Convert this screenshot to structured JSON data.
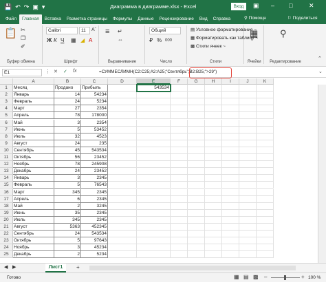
{
  "window": {
    "title": "Диаграмма в диаграмме.xlsx - Excel",
    "signin": "Вход",
    "qat_icons": [
      "save-icon",
      "undo-icon",
      "redo-icon",
      "image-icon",
      "customize-icon"
    ],
    "controls": [
      "ribbon-display-icon",
      "minimize-icon",
      "maximize-icon",
      "close-icon"
    ]
  },
  "tabs": [
    "Файл",
    "Главная",
    "Вставка",
    "Разметка страницы",
    "Формулы",
    "Данные",
    "Рецензирование",
    "Вид",
    "Справка"
  ],
  "tabs_extra": {
    "tell_me": "Помощн",
    "share": "Поделиться"
  },
  "ribbon": {
    "clipboard": {
      "label": "Буфер обмена"
    },
    "font": {
      "label": "Шрифт",
      "name": "Calibri",
      "size": "11"
    },
    "alignment": {
      "label": "Выравнивание"
    },
    "number": {
      "label": "Число",
      "format": "Общий"
    },
    "styles": {
      "label": "Стили",
      "items": [
        "Условное форматирование ~",
        "Форматировать как таблицу ~",
        "Стили ячеек ~"
      ]
    },
    "cells": {
      "label": "Ячейки"
    },
    "editing": {
      "label": "Редактирование"
    }
  },
  "formula_bar": {
    "name_box": "E1",
    "formula": "=СУММЕСЛИМН(C2:C25;A2:A25;\"Сентябрь\";B2:B25;\">29\")",
    "fx": "fx"
  },
  "columns": [
    "A",
    "B",
    "C",
    "D",
    "E",
    "F",
    "G",
    "H",
    "I",
    "J",
    "K"
  ],
  "selected_column": "E",
  "headers": {
    "a": "Месяц",
    "b": "Продано",
    "c": "Прибыль"
  },
  "result": "543534",
  "rows": [
    {
      "a": "Январь",
      "b": "14",
      "c": "54234"
    },
    {
      "a": "Февраль",
      "b": "24",
      "c": "5234"
    },
    {
      "a": "Март",
      "b": "27",
      "c": "2354"
    },
    {
      "a": "Апрель",
      "b": "78",
      "c": "178000"
    },
    {
      "a": "Май",
      "b": "3",
      "c": "2354"
    },
    {
      "a": "Июнь",
      "b": "5",
      "c": "53452"
    },
    {
      "a": "Июль",
      "b": "32",
      "c": "4523"
    },
    {
      "a": "Август",
      "b": "24",
      "c": "235"
    },
    {
      "a": "Сентябрь",
      "b": "45",
      "c": "543534"
    },
    {
      "a": "Октябрь",
      "b": "56",
      "c": "23452"
    },
    {
      "a": "Ноябрь",
      "b": "78",
      "c": "245908"
    },
    {
      "a": "Декабрь",
      "b": "24",
      "c": "23452"
    },
    {
      "a": "Январь",
      "b": "3",
      "c": "2345"
    },
    {
      "a": "Февраль",
      "b": "5",
      "c": "76543"
    },
    {
      "a": "Март",
      "b": "345",
      "c": "2345"
    },
    {
      "a": "Апрель",
      "b": "6",
      "c": "2345"
    },
    {
      "a": "Май",
      "b": "2",
      "c": "3245"
    },
    {
      "a": "Июнь",
      "b": "35",
      "c": "2345"
    },
    {
      "a": "Июль",
      "b": "345",
      "c": "2345"
    },
    {
      "a": "Август",
      "b": "5363",
      "c": "452345"
    },
    {
      "a": "Сентябрь",
      "b": "24",
      "c": "543534"
    },
    {
      "a": "Октябрь",
      "b": "5",
      "c": "97643"
    },
    {
      "a": "Ноябрь",
      "b": "3",
      "c": "45234"
    },
    {
      "a": "Декабрь",
      "b": "2",
      "c": "5234"
    }
  ],
  "sheet": {
    "name": "Лист1",
    "add": "+"
  },
  "status": {
    "text": "Готово",
    "zoom": "100 %"
  },
  "colors": {
    "brand": "#217346",
    "highlight": "#e3453b"
  }
}
